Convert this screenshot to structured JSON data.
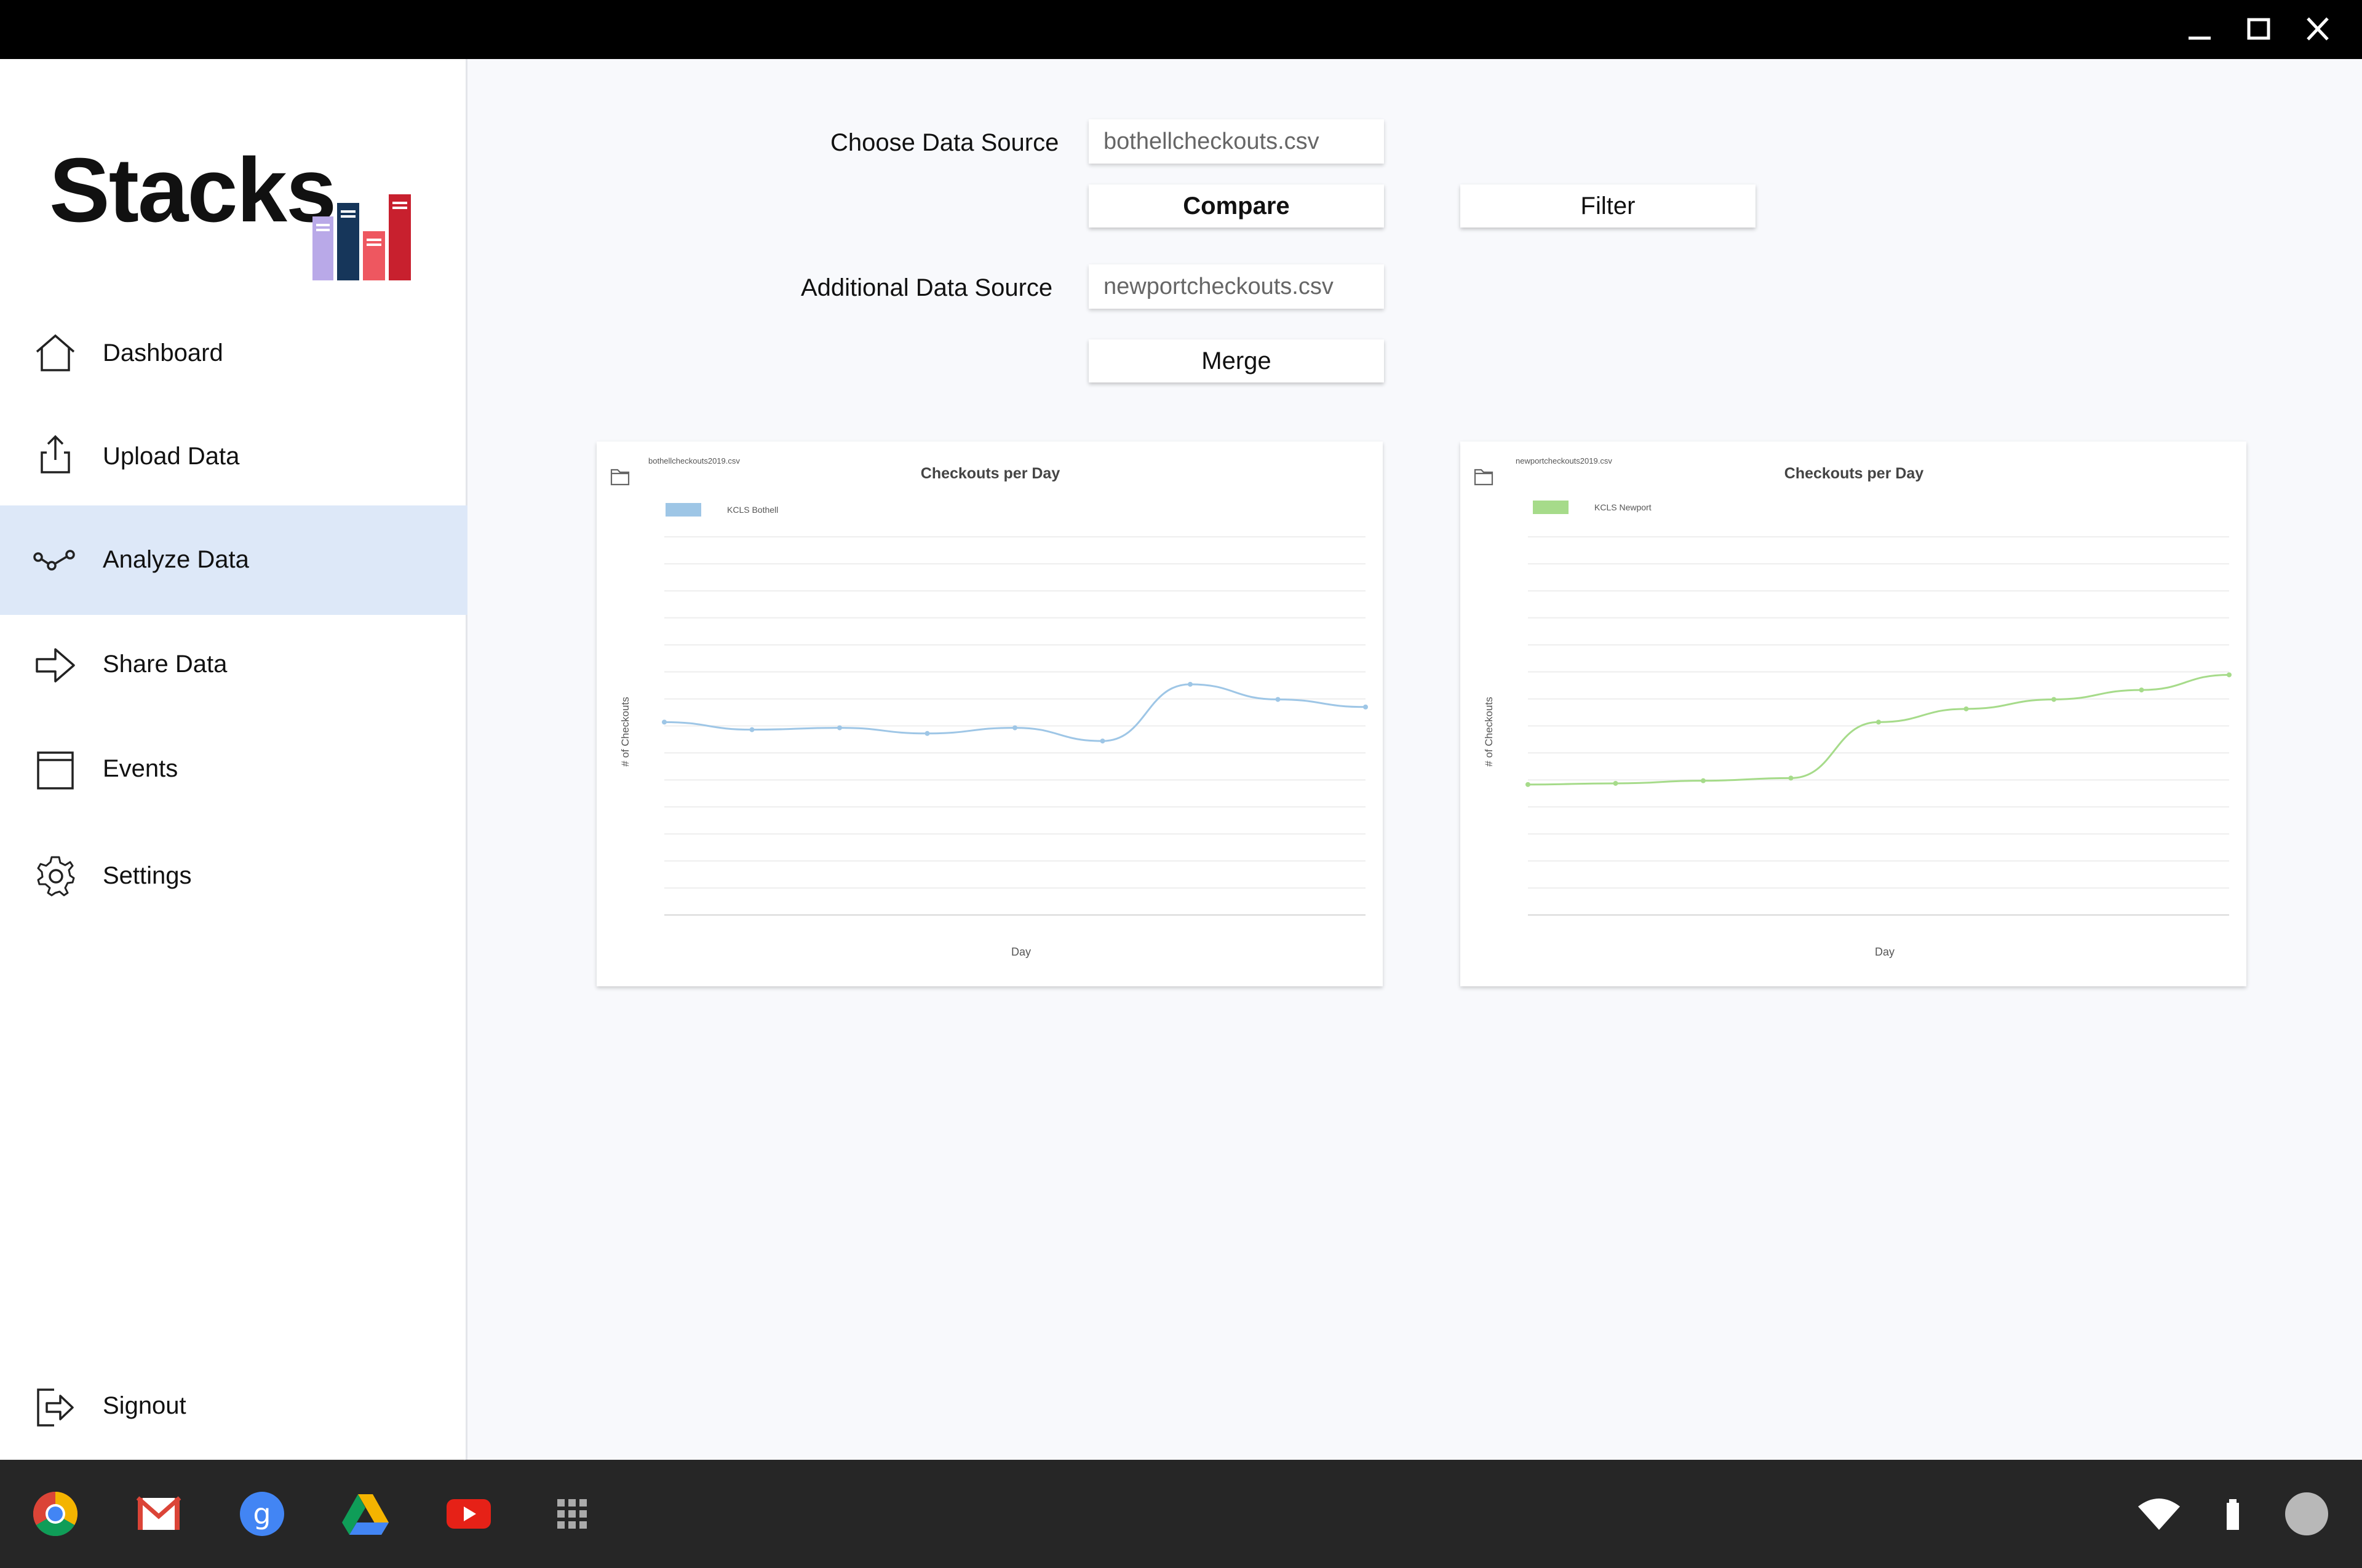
{
  "app": {
    "logo_text": "Stacks",
    "brand_colors": {
      "lavender": "#b9a9e8",
      "navy": "#16365a",
      "coral": "#ee5760",
      "red": "#c8202e"
    }
  },
  "window_controls": {
    "minimize": "minimize-icon",
    "maximize": "maximize-icon",
    "close": "close-icon"
  },
  "sidebar": {
    "items": [
      {
        "label": "Dashboard",
        "icon": "home-icon",
        "active": false
      },
      {
        "label": "Upload Data",
        "icon": "upload-icon",
        "active": false
      },
      {
        "label": "Analyze Data",
        "icon": "analyze-icon",
        "active": true
      },
      {
        "label": "Share Data",
        "icon": "arrow-right-icon",
        "active": false
      },
      {
        "label": "Events",
        "icon": "calendar-icon",
        "active": false
      },
      {
        "label": "Settings",
        "icon": "gear-icon",
        "active": false
      }
    ],
    "signout": {
      "label": "Signout",
      "icon": "signout-icon"
    },
    "active_color": "#dde8f8"
  },
  "controls": {
    "choose_label": "Choose Data Source",
    "choose_value": "bothellcheckouts.csv",
    "compare_label": "Compare",
    "filter_label": "Filter",
    "additional_label": "Additional Data Source",
    "additional_value": "newportcheckouts.csv",
    "merge_label": "Merge"
  },
  "chart_data": [
    {
      "type": "line",
      "file_label": "bothellcheckouts2019.csv",
      "title": "Checkouts per Day",
      "xlabel": "Day",
      "ylabel": "# of Checkouts",
      "series": [
        {
          "name": "KCLS Bothell",
          "color": "#9ec6e6",
          "values": [
            0.51,
            0.49,
            0.495,
            0.48,
            0.495,
            0.46,
            0.61,
            0.57,
            0.55
          ]
        }
      ],
      "categories": [
        "",
        "",
        "",
        "",
        "",
        "",
        "",
        "",
        ""
      ],
      "ylim": [
        0,
        1
      ],
      "legend": "top-left",
      "grid": true
    },
    {
      "type": "line",
      "file_label": "newportcheckouts2019.csv",
      "title": "Checkouts per Day",
      "xlabel": "Day",
      "ylabel": "# of Checkouts",
      "series": [
        {
          "name": "KCLS Newport",
          "color": "#a6db8a",
          "values": [
            0.345,
            0.348,
            0.355,
            0.362,
            0.51,
            0.545,
            0.57,
            0.595,
            0.635
          ]
        }
      ],
      "categories": [
        "",
        "",
        "",
        "",
        "",
        "",
        "",
        "",
        ""
      ],
      "ylim": [
        0,
        1
      ],
      "legend": "top-left",
      "grid": true
    }
  ],
  "shelf": {
    "apps": [
      "chrome-icon",
      "gmail-icon",
      "google-search-icon",
      "drive-icon",
      "youtube-icon",
      "launcher-icon"
    ],
    "tray": [
      "wifi-icon",
      "battery-icon",
      "account-avatar"
    ]
  }
}
